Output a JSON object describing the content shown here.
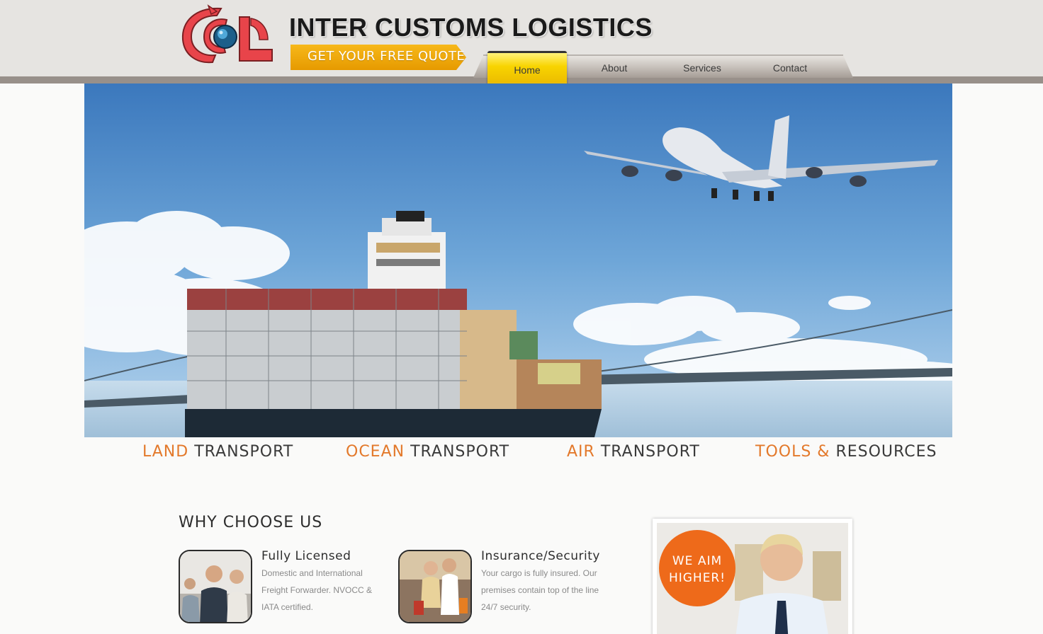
{
  "header": {
    "brand_title": "INTER CUSTOMS LOGISTICS",
    "quote_button": "GET YOUR FREE QUOTE",
    "logo_text": "ICL"
  },
  "nav": {
    "items": [
      {
        "label": "Home",
        "active": true
      },
      {
        "label": "About"
      },
      {
        "label": "Services"
      },
      {
        "label": "Contact"
      }
    ]
  },
  "categories": [
    {
      "highlight": "LAND",
      "rest": "TRANSPORT"
    },
    {
      "highlight": "OCEAN",
      "rest": "TRANSPORT"
    },
    {
      "highlight": "AIR",
      "rest": "TRANSPORT"
    },
    {
      "highlight": "TOOLS &",
      "rest": "RESOURCES"
    }
  ],
  "why": {
    "title": "WHY CHOOSE US",
    "features": [
      {
        "title": "Fully Licensed",
        "text": "Domestic and International Freight Forwarder. NVOCC & IATA certified."
      },
      {
        "title": "Insurance/Security",
        "text": "Your cargo is fully insured. Our premises contain top of the line 24/7 security."
      }
    ]
  },
  "promo": {
    "line1": "WE AIM",
    "line2": "HIGHER!"
  },
  "colors": {
    "accent_orange": "#e3792b",
    "quote_yellow": "#f2a900",
    "nav_active": "#f8d400",
    "header_bg": "#e6e4e1",
    "header_band": "#98908a"
  }
}
